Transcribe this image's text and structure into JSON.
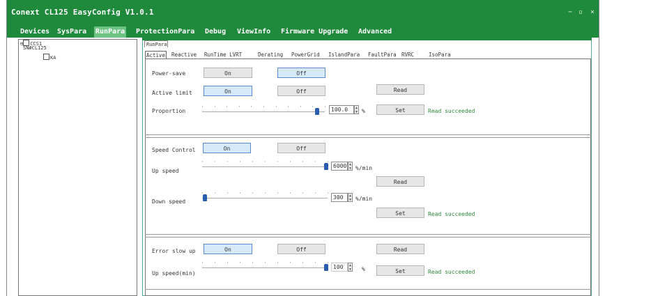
{
  "window": {
    "title": "Conext CL125 EasyConfig V1.0.1",
    "min": "−",
    "max": "▫",
    "close": "×"
  },
  "menu": [
    "Devices",
    "SysPara",
    "RunPara",
    "ProtectionPara",
    "Debug",
    "ViewInfo",
    "Firmware Upgrade",
    "Advanced"
  ],
  "tree": {
    "root": "CCS1",
    "child": "SN#CL125",
    "leaf": "KA"
  },
  "panel_tab": "RunPara",
  "tabs": [
    "Active",
    "Reactive",
    "RunTime LVRT",
    "Derating",
    "PowerGrid",
    "IslandPara",
    "FaultPara",
    "RVRC",
    "IsoPara"
  ],
  "section1": {
    "power_save": {
      "label": "Power-save",
      "on": "On",
      "off": "Off",
      "selected": "off"
    },
    "active_limit": {
      "label": "Active limit",
      "on": "On",
      "off": "Off",
      "read": "Read",
      "selected": "on"
    },
    "proportion": {
      "label": "Proportion",
      "value": "100.0",
      "unit": "%",
      "set": "Set",
      "status": "Read succeeded",
      "level": 1.0
    }
  },
  "section2": {
    "speed_control": {
      "label": "Speed Control",
      "on": "On",
      "off": "Off",
      "selected": "on"
    },
    "up_speed": {
      "label": "Up speed",
      "value": "6000",
      "unit": "%/min",
      "read": "Read",
      "level": 1.0
    },
    "down_speed": {
      "label": "Down speed",
      "value": "300",
      "unit": "%/min",
      "set": "Set",
      "status": "Read succeeded",
      "level": 0.0
    }
  },
  "section3": {
    "error_slow_up": {
      "label": "Error slow up",
      "on": "On",
      "off": "Off",
      "read": "Read",
      "selected": "on"
    },
    "up_speed_min": {
      "label": "Up speed(min)",
      "value": "100",
      "unit": "%",
      "set": "Set",
      "status": "Read succeeded",
      "level": 1.0
    }
  }
}
